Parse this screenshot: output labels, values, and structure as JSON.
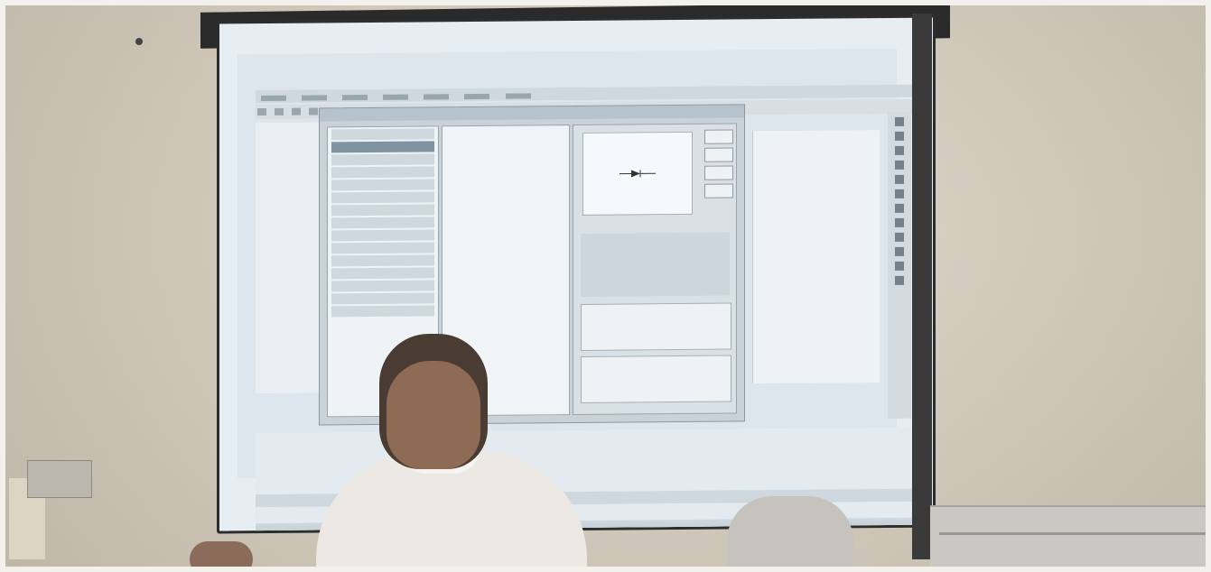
{
  "scene": {
    "description": "",
    "colors": {
      "wall": "#d6cdbd",
      "screen": "#e6eef4",
      "dialog": "#c9d2d9",
      "shirt": "#ece9e5",
      "skin": "#8d6b55"
    },
    "icons": [
      "diode-symbol-icon",
      "toolbar-icon",
      "tool-icon"
    ]
  }
}
